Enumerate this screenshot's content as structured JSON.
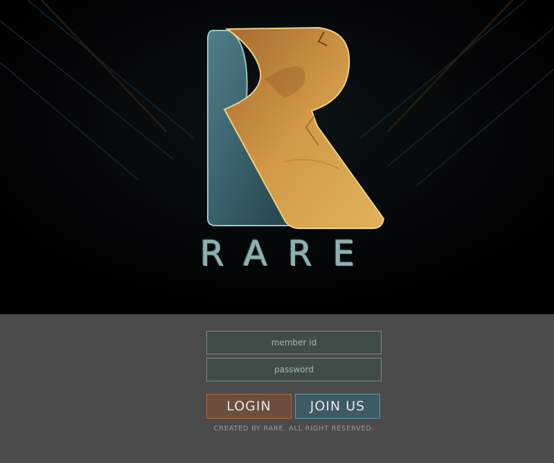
{
  "brand": {
    "wordmark": "RARE",
    "colors": {
      "orange": "#c98a3a",
      "teal": "#3f6d77",
      "background": "#000000",
      "panel": "#4b4b4b"
    }
  },
  "login": {
    "member_id_placeholder": "member id",
    "password_placeholder": "password",
    "login_label": "LOGIN",
    "join_label": "JOIN US"
  },
  "footer": {
    "text": "CREATED BY  RARE.  ALL RIGHT RESERVED."
  }
}
